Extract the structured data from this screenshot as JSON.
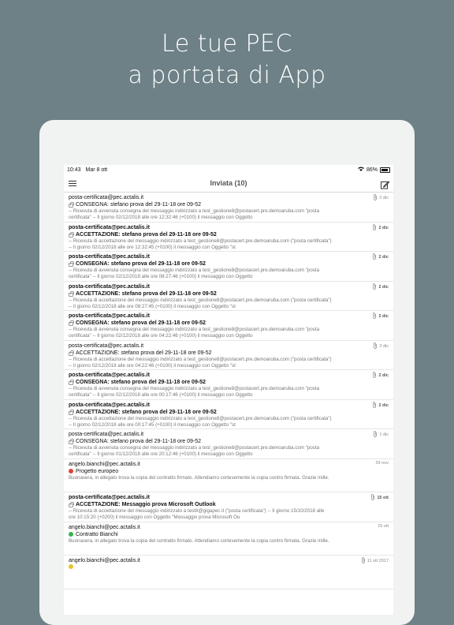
{
  "headline": {
    "line1": "Le tue PEC",
    "line2": "a portata di App"
  },
  "status": {
    "time": "10:43",
    "date": "Mar 8 ott",
    "battery": "86%",
    "wifi_icon": "wifi-icon"
  },
  "nav": {
    "title": "Inviata (10)",
    "menu_icon": "menu-icon",
    "compose_icon": "compose-icon"
  },
  "messages": [
    {
      "sender": "posta-certificata@pec.actalis.it",
      "unread": false,
      "attach": true,
      "date": "2 dic",
      "icon": "lock",
      "subject": "CONSEGNA: stefano prova del 29-11-18 ore 09-52",
      "p1": "-- Ricevuta di avvenuta consegna del messaggio indirizzato a test_gestione8@postacert.pre.demoaruba.com \"posta",
      "p2": "certificata\" --  Il giorno 02/12/2018 alle ore 12:32:46 (+0100) il messaggio con Oggetto"
    },
    {
      "sender": "posta-certificata@pec.actalis.it",
      "unread": true,
      "attach": true,
      "date": "2 dic",
      "icon": "lock",
      "subject": "ACCETTAZIONE: stefano prova del 29-11-18 ore 09-52",
      "p1": "-- Ricevuta di accettazione del messaggio indirizzato a test_gestione8@postacert.pre.demoaruba.com (\"posta certificata\")",
      "p2": "--  Il giorno 02/12/2018 alle ore 12:32:45 (+0100) il messaggio con Oggetto \"st"
    },
    {
      "sender": "posta-certificata@pec.actalis.it",
      "unread": true,
      "attach": true,
      "date": "2 dic",
      "icon": "lock",
      "subject": "CONSEGNA: stefano prova del 29-11-18 ore 09-52",
      "p1": "-- Ricevuta di avvenuta consegna del messaggio indirizzato a test_gestione8@postacert.pre.demoaruba.com \"posta",
      "p2": "certificata\" --  Il giorno 02/12/2018 alle ore 08:27:46 (+0100) il messaggio con Oggetto"
    },
    {
      "sender": "posta-certificata@pec.actalis.it",
      "unread": true,
      "attach": true,
      "date": "2 dic",
      "icon": "lock",
      "subject": "ACCETTAZIONE: stefano prova del 29-11-18 ore 09-52",
      "p1": "-- Ricevuta di accettazione del messaggio indirizzato a test_gestione8@postacert.pre.demoaruba.com (\"posta certificata\")",
      "p2": "--  Il giorno 02/12/2018 alle ore 08:27:45 (+0100) il messaggio con Oggetto \"st"
    },
    {
      "sender": "posta-certificata@pec.actalis.it",
      "unread": true,
      "attach": true,
      "date": "2 dic",
      "icon": "lock",
      "subject": "CONSEGNA: stefano prova del 29-11-18 ore 09-52",
      "p1": "-- Ricevuta di avvenuta consegna del messaggio indirizzato a test_gestione8@postacert.pre.demoaruba.com \"posta",
      "p2": "certificata\" --  Il giorno 02/12/2018 alle ore 04:22:46 (+0100) il messaggio con Oggetto"
    },
    {
      "sender": "posta-certificata@pec.actalis.it",
      "unread": false,
      "attach": true,
      "date": "2 dic",
      "icon": "lock",
      "subject": "ACCETTAZIONE: stefano prova del 29-11-18 ore 09-52",
      "p1": "-- Ricevuta di accettazione del messaggio indirizzato a test_gestione8@postacert.pre.demoaruba.com (\"posta certificata\")",
      "p2": "--  Il giorno 02/12/2018 alle ore 04:22:46 (+0100) il messaggio con Oggetto \"st"
    },
    {
      "sender": "posta-certificata@pec.actalis.it",
      "unread": true,
      "attach": true,
      "date": "2 dic",
      "icon": "lock",
      "subject": "CONSEGNA: stefano prova del 29-11-18 ore 09-52",
      "p1": "-- Ricevuta di avvenuta consegna del messaggio indirizzato a test_gestione8@postacert.pre.demoaruba.com \"posta",
      "p2": "certificata\" --  Il giorno 02/12/2018 alle ore 00:17:46 (+0100) il messaggio con Oggetto"
    },
    {
      "sender": "posta-certificata@pec.actalis.it",
      "unread": true,
      "attach": true,
      "date": "2 dic",
      "icon": "lock",
      "subject": "ACCETTAZIONE: stefano prova del 29-11-18 ore 09-52",
      "p1": "-- Ricevuta di accettazione del messaggio indirizzato a test_gestione8@postacert.pre.demoaruba.com (\"posta certificata\")",
      "p2": "--  Il giorno 02/12/2018 alle ore 00:17:45 (+0100) il messaggio con Oggetto \"st"
    },
    {
      "sender": "posta-certificata@pec.actalis.it",
      "unread": false,
      "attach": true,
      "date": "1 dic",
      "icon": "lock",
      "subject": "CONSEGNA: stefano prova del 29-11-18 ore 09-52",
      "p1": "-- Ricevuta di avvenuta consegna del messaggio indirizzato a test_gestione8@postacert.pre.demoaruba.com \"posta",
      "p2": "certificata\" --  Il giorno 01/12/2018 alle ore 20:12:46 (+0100) il messaggio con Oggetto"
    },
    {
      "sender": "angelo.bianchi@pec.actalis.it",
      "unread": false,
      "attach": false,
      "date": "29 nov",
      "icon": "red",
      "subject": "Progetto europeo",
      "p1": "Buonasera, in allegato trova la copia del contratto firmato. Attendiamo cortesemente la copia contro firmata. Grazie mille.",
      "p2": ""
    },
    {
      "sender": "posta-certificata@pec.actalis.it",
      "unread": true,
      "attach": true,
      "date": "15 ott",
      "icon": "lock",
      "subject": "ACCETTAZIONE: Messaggio prova Microsoft Outlook",
      "p1": "-- Ricevuta di accettazione del messaggio indirizzato a test8@gigapec.it (\"posta certificata\") --  Il giorno 15/10/2018 alle",
      "p2": "ore 10:15:20 (+0200) il messaggio con Oggetto \"Messaggio prova Microsoft Ou"
    },
    {
      "sender": "angelo.bianchi@pec.actalis.it",
      "unread": false,
      "attach": false,
      "date": "15 ott",
      "icon": "green",
      "subject": "Contratto Bianchi",
      "p1": "Buonasera, in allegato trova la copia del contratto firmato. Attendiamo cortesemente la copia contro firmata. Grazie mille.",
      "p2": ""
    },
    {
      "sender": "angelo.bianchi@pec.actalis.it",
      "unread": false,
      "attach": true,
      "date": "11 ott 2017",
      "icon": "yellow",
      "subject": "",
      "p1": "",
      "p2": ""
    }
  ],
  "colors": {
    "background": "#6d8186",
    "red": "#e0433a",
    "green": "#39b24a",
    "yellow": "#e9c32c"
  }
}
